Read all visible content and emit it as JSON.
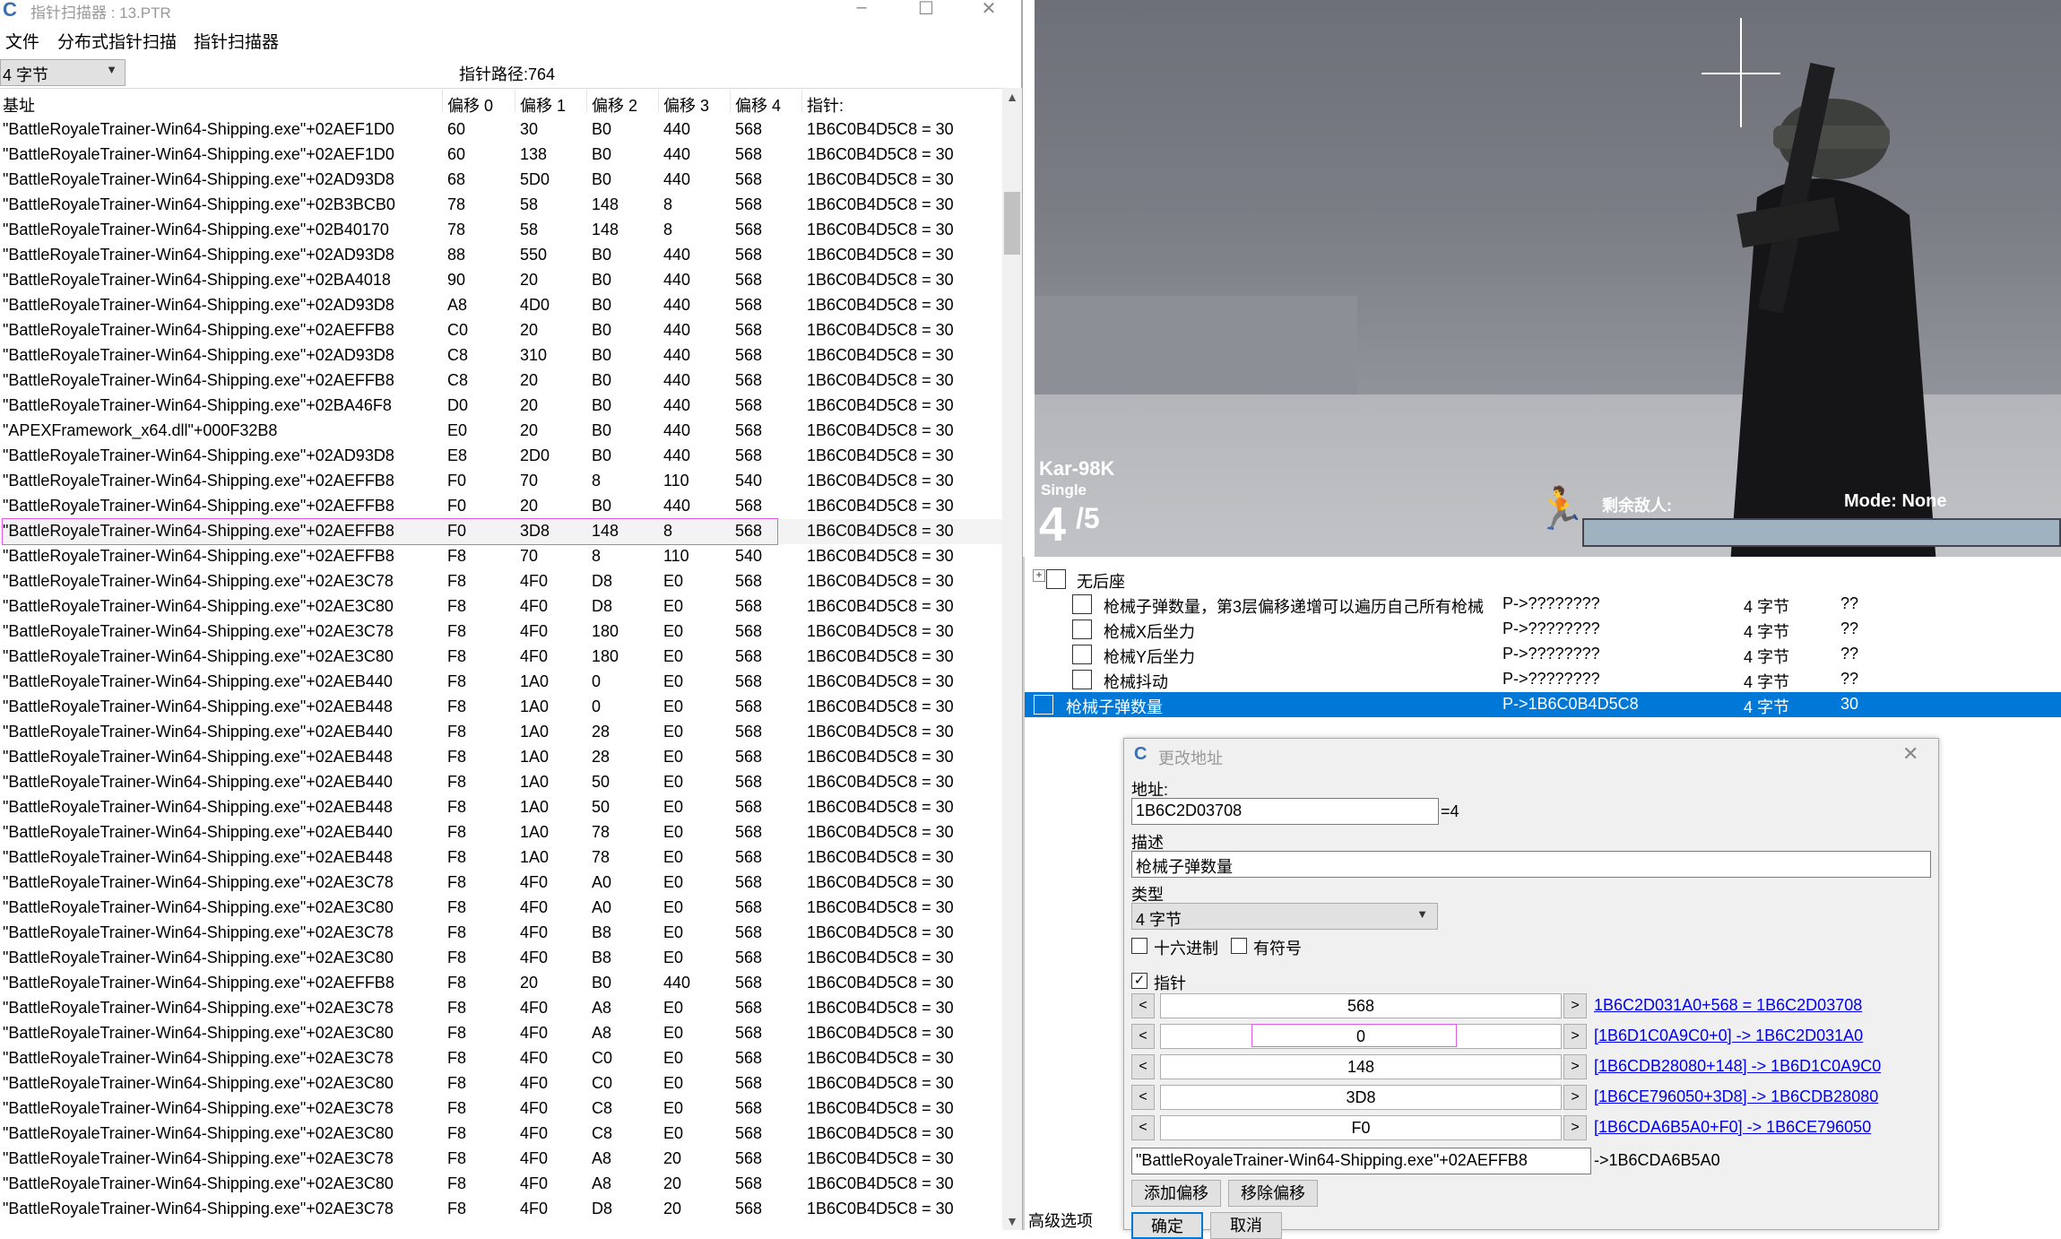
{
  "scanner": {
    "title": "指针扫描器 : 13.PTR",
    "menu": [
      "文件",
      "分布式指针扫描",
      "指针扫描器"
    ],
    "type_combo": "4 字节",
    "path_count": "指针路径:764",
    "columns": [
      "基址",
      "偏移 0",
      "偏移 1",
      "偏移 2",
      "偏移 3",
      "偏移 4",
      "指针:"
    ],
    "rows": [
      [
        "\"BattleRoyaleTrainer-Win64-Shipping.exe\"+02AEF1D0",
        "60",
        "30",
        "B0",
        "440",
        "568",
        "1B6C0B4D5C8 = 30"
      ],
      [
        "\"BattleRoyaleTrainer-Win64-Shipping.exe\"+02AEF1D0",
        "60",
        "138",
        "B0",
        "440",
        "568",
        "1B6C0B4D5C8 = 30"
      ],
      [
        "\"BattleRoyaleTrainer-Win64-Shipping.exe\"+02AD93D8",
        "68",
        "5D0",
        "B0",
        "440",
        "568",
        "1B6C0B4D5C8 = 30"
      ],
      [
        "\"BattleRoyaleTrainer-Win64-Shipping.exe\"+02B3BCB0",
        "78",
        "58",
        "148",
        "8",
        "568",
        "1B6C0B4D5C8 = 30"
      ],
      [
        "\"BattleRoyaleTrainer-Win64-Shipping.exe\"+02B40170",
        "78",
        "58",
        "148",
        "8",
        "568",
        "1B6C0B4D5C8 = 30"
      ],
      [
        "\"BattleRoyaleTrainer-Win64-Shipping.exe\"+02AD93D8",
        "88",
        "550",
        "B0",
        "440",
        "568",
        "1B6C0B4D5C8 = 30"
      ],
      [
        "\"BattleRoyaleTrainer-Win64-Shipping.exe\"+02BA4018",
        "90",
        "20",
        "B0",
        "440",
        "568",
        "1B6C0B4D5C8 = 30"
      ],
      [
        "\"BattleRoyaleTrainer-Win64-Shipping.exe\"+02AD93D8",
        "A8",
        "4D0",
        "B0",
        "440",
        "568",
        "1B6C0B4D5C8 = 30"
      ],
      [
        "\"BattleRoyaleTrainer-Win64-Shipping.exe\"+02AEFFB8",
        "C0",
        "20",
        "B0",
        "440",
        "568",
        "1B6C0B4D5C8 = 30"
      ],
      [
        "\"BattleRoyaleTrainer-Win64-Shipping.exe\"+02AD93D8",
        "C8",
        "310",
        "B0",
        "440",
        "568",
        "1B6C0B4D5C8 = 30"
      ],
      [
        "\"BattleRoyaleTrainer-Win64-Shipping.exe\"+02AEFFB8",
        "C8",
        "20",
        "B0",
        "440",
        "568",
        "1B6C0B4D5C8 = 30"
      ],
      [
        "\"BattleRoyaleTrainer-Win64-Shipping.exe\"+02BA46F8",
        "D0",
        "20",
        "B0",
        "440",
        "568",
        "1B6C0B4D5C8 = 30"
      ],
      [
        "\"APEXFramework_x64.dll\"+000F32B8",
        "E0",
        "20",
        "B0",
        "440",
        "568",
        "1B6C0B4D5C8 = 30"
      ],
      [
        "\"BattleRoyaleTrainer-Win64-Shipping.exe\"+02AD93D8",
        "E8",
        "2D0",
        "B0",
        "440",
        "568",
        "1B6C0B4D5C8 = 30"
      ],
      [
        "\"BattleRoyaleTrainer-Win64-Shipping.exe\"+02AEFFB8",
        "F0",
        "70",
        "8",
        "110",
        "540",
        "1B6C0B4D5C8 = 30"
      ],
      [
        "\"BattleRoyaleTrainer-Win64-Shipping.exe\"+02AEFFB8",
        "F0",
        "20",
        "B0",
        "440",
        "568",
        "1B6C0B4D5C8 = 30"
      ],
      [
        "\"BattleRoyaleTrainer-Win64-Shipping.exe\"+02AEFFB8",
        "F0",
        "3D8",
        "148",
        "8",
        "568",
        "1B6C0B4D5C8 = 30"
      ],
      [
        "\"BattleRoyaleTrainer-Win64-Shipping.exe\"+02AEFFB8",
        "F8",
        "70",
        "8",
        "110",
        "540",
        "1B6C0B4D5C8 = 30"
      ],
      [
        "\"BattleRoyaleTrainer-Win64-Shipping.exe\"+02AE3C78",
        "F8",
        "4F0",
        "D8",
        "E0",
        "568",
        "1B6C0B4D5C8 = 30"
      ],
      [
        "\"BattleRoyaleTrainer-Win64-Shipping.exe\"+02AE3C80",
        "F8",
        "4F0",
        "D8",
        "E0",
        "568",
        "1B6C0B4D5C8 = 30"
      ],
      [
        "\"BattleRoyaleTrainer-Win64-Shipping.exe\"+02AE3C78",
        "F8",
        "4F0",
        "180",
        "E0",
        "568",
        "1B6C0B4D5C8 = 30"
      ],
      [
        "\"BattleRoyaleTrainer-Win64-Shipping.exe\"+02AE3C80",
        "F8",
        "4F0",
        "180",
        "E0",
        "568",
        "1B6C0B4D5C8 = 30"
      ],
      [
        "\"BattleRoyaleTrainer-Win64-Shipping.exe\"+02AEB440",
        "F8",
        "1A0",
        "0",
        "E0",
        "568",
        "1B6C0B4D5C8 = 30"
      ],
      [
        "\"BattleRoyaleTrainer-Win64-Shipping.exe\"+02AEB448",
        "F8",
        "1A0",
        "0",
        "E0",
        "568",
        "1B6C0B4D5C8 = 30"
      ],
      [
        "\"BattleRoyaleTrainer-Win64-Shipping.exe\"+02AEB440",
        "F8",
        "1A0",
        "28",
        "E0",
        "568",
        "1B6C0B4D5C8 = 30"
      ],
      [
        "\"BattleRoyaleTrainer-Win64-Shipping.exe\"+02AEB448",
        "F8",
        "1A0",
        "28",
        "E0",
        "568",
        "1B6C0B4D5C8 = 30"
      ],
      [
        "\"BattleRoyaleTrainer-Win64-Shipping.exe\"+02AEB440",
        "F8",
        "1A0",
        "50",
        "E0",
        "568",
        "1B6C0B4D5C8 = 30"
      ],
      [
        "\"BattleRoyaleTrainer-Win64-Shipping.exe\"+02AEB448",
        "F8",
        "1A0",
        "50",
        "E0",
        "568",
        "1B6C0B4D5C8 = 30"
      ],
      [
        "\"BattleRoyaleTrainer-Win64-Shipping.exe\"+02AEB440",
        "F8",
        "1A0",
        "78",
        "E0",
        "568",
        "1B6C0B4D5C8 = 30"
      ],
      [
        "\"BattleRoyaleTrainer-Win64-Shipping.exe\"+02AEB448",
        "F8",
        "1A0",
        "78",
        "E0",
        "568",
        "1B6C0B4D5C8 = 30"
      ],
      [
        "\"BattleRoyaleTrainer-Win64-Shipping.exe\"+02AE3C78",
        "F8",
        "4F0",
        "A0",
        "E0",
        "568",
        "1B6C0B4D5C8 = 30"
      ],
      [
        "\"BattleRoyaleTrainer-Win64-Shipping.exe\"+02AE3C80",
        "F8",
        "4F0",
        "A0",
        "E0",
        "568",
        "1B6C0B4D5C8 = 30"
      ],
      [
        "\"BattleRoyaleTrainer-Win64-Shipping.exe\"+02AE3C78",
        "F8",
        "4F0",
        "B8",
        "E0",
        "568",
        "1B6C0B4D5C8 = 30"
      ],
      [
        "\"BattleRoyaleTrainer-Win64-Shipping.exe\"+02AE3C80",
        "F8",
        "4F0",
        "B8",
        "E0",
        "568",
        "1B6C0B4D5C8 = 30"
      ],
      [
        "\"BattleRoyaleTrainer-Win64-Shipping.exe\"+02AEFFB8",
        "F8",
        "20",
        "B0",
        "440",
        "568",
        "1B6C0B4D5C8 = 30"
      ],
      [
        "\"BattleRoyaleTrainer-Win64-Shipping.exe\"+02AE3C78",
        "F8",
        "4F0",
        "A8",
        "E0",
        "568",
        "1B6C0B4D5C8 = 30"
      ],
      [
        "\"BattleRoyaleTrainer-Win64-Shipping.exe\"+02AE3C80",
        "F8",
        "4F0",
        "A8",
        "E0",
        "568",
        "1B6C0B4D5C8 = 30"
      ],
      [
        "\"BattleRoyaleTrainer-Win64-Shipping.exe\"+02AE3C78",
        "F8",
        "4F0",
        "C0",
        "E0",
        "568",
        "1B6C0B4D5C8 = 30"
      ],
      [
        "\"BattleRoyaleTrainer-Win64-Shipping.exe\"+02AE3C80",
        "F8",
        "4F0",
        "C0",
        "E0",
        "568",
        "1B6C0B4D5C8 = 30"
      ],
      [
        "\"BattleRoyaleTrainer-Win64-Shipping.exe\"+02AE3C78",
        "F8",
        "4F0",
        "C8",
        "E0",
        "568",
        "1B6C0B4D5C8 = 30"
      ],
      [
        "\"BattleRoyaleTrainer-Win64-Shipping.exe\"+02AE3C80",
        "F8",
        "4F0",
        "C8",
        "E0",
        "568",
        "1B6C0B4D5C8 = 30"
      ],
      [
        "\"BattleRoyaleTrainer-Win64-Shipping.exe\"+02AE3C78",
        "F8",
        "4F0",
        "A8",
        "20",
        "568",
        "1B6C0B4D5C8 = 30"
      ],
      [
        "\"BattleRoyaleTrainer-Win64-Shipping.exe\"+02AE3C80",
        "F8",
        "4F0",
        "A8",
        "20",
        "568",
        "1B6C0B4D5C8 = 30"
      ],
      [
        "\"BattleRoyaleTrainer-Win64-Shipping.exe\"+02AE3C78",
        "F8",
        "4F0",
        "D8",
        "20",
        "568",
        "1B6C0B4D5C8 = 30"
      ]
    ],
    "selected_row": 16
  },
  "game": {
    "weapon": "Kar-98K",
    "fire_mode": "Single",
    "ammo_current": "4",
    "ammo_max": "/5",
    "enemies_label": "剩余敌人:",
    "mode_label": "Mode:",
    "mode_value": "None"
  },
  "celist": {
    "rows": [
      {
        "desc": "无后座",
        "kind": "group"
      },
      {
        "desc": "枪械子弹数量，第3层偏移递增可以遍历自己所有枪械",
        "addr": "P->????????",
        "type": "4 字节",
        "value": "??"
      },
      {
        "desc": "枪械X后坐力",
        "addr": "P->????????",
        "type": "4 字节",
        "value": "??"
      },
      {
        "desc": "枪械Y后坐力",
        "addr": "P->????????",
        "type": "4 字节",
        "value": "??"
      },
      {
        "desc": "枪械抖动",
        "addr": "P->????????",
        "type": "4 字节",
        "value": "??"
      },
      {
        "desc": "枪械子弹数量",
        "addr": "P->1B6C0B4D5C8",
        "type": "4 字节",
        "value": "30"
      }
    ],
    "advanced": "高级选项"
  },
  "dialog": {
    "title": "更改地址",
    "address_label": "地址:",
    "address_value": "1B6C2D03708",
    "address_suffix": "=4",
    "desc_label": "描述",
    "desc_value": "枪械子弹数量",
    "type_label": "类型",
    "type_value": "4 字节",
    "hex_label": "十六进制",
    "signed_label": "有符号",
    "pointer_label": "指针",
    "offsets": [
      {
        "value": "568",
        "link": "1B6C2D031A0+568 = 1B6C2D03708"
      },
      {
        "value": "0",
        "link": "[1B6D1C0A9C0+0] -> 1B6C2D031A0"
      },
      {
        "value": "148",
        "link": "[1B6CDB28080+148] -> 1B6D1C0A9C0"
      },
      {
        "value": "3D8",
        "link": "[1B6CE796050+3D8] -> 1B6CDB28080"
      },
      {
        "value": "F0",
        "link": "[1B6CDA6B5A0+F0] -> 1B6CE796050"
      }
    ],
    "base_value": "\"BattleRoyaleTrainer-Win64-Shipping.exe\"+02AEFFB8",
    "base_result": "->1B6CDA6B5A0",
    "add_offset": "添加偏移",
    "remove_offset": "移除偏移",
    "ok": "确定",
    "cancel": "取消"
  }
}
